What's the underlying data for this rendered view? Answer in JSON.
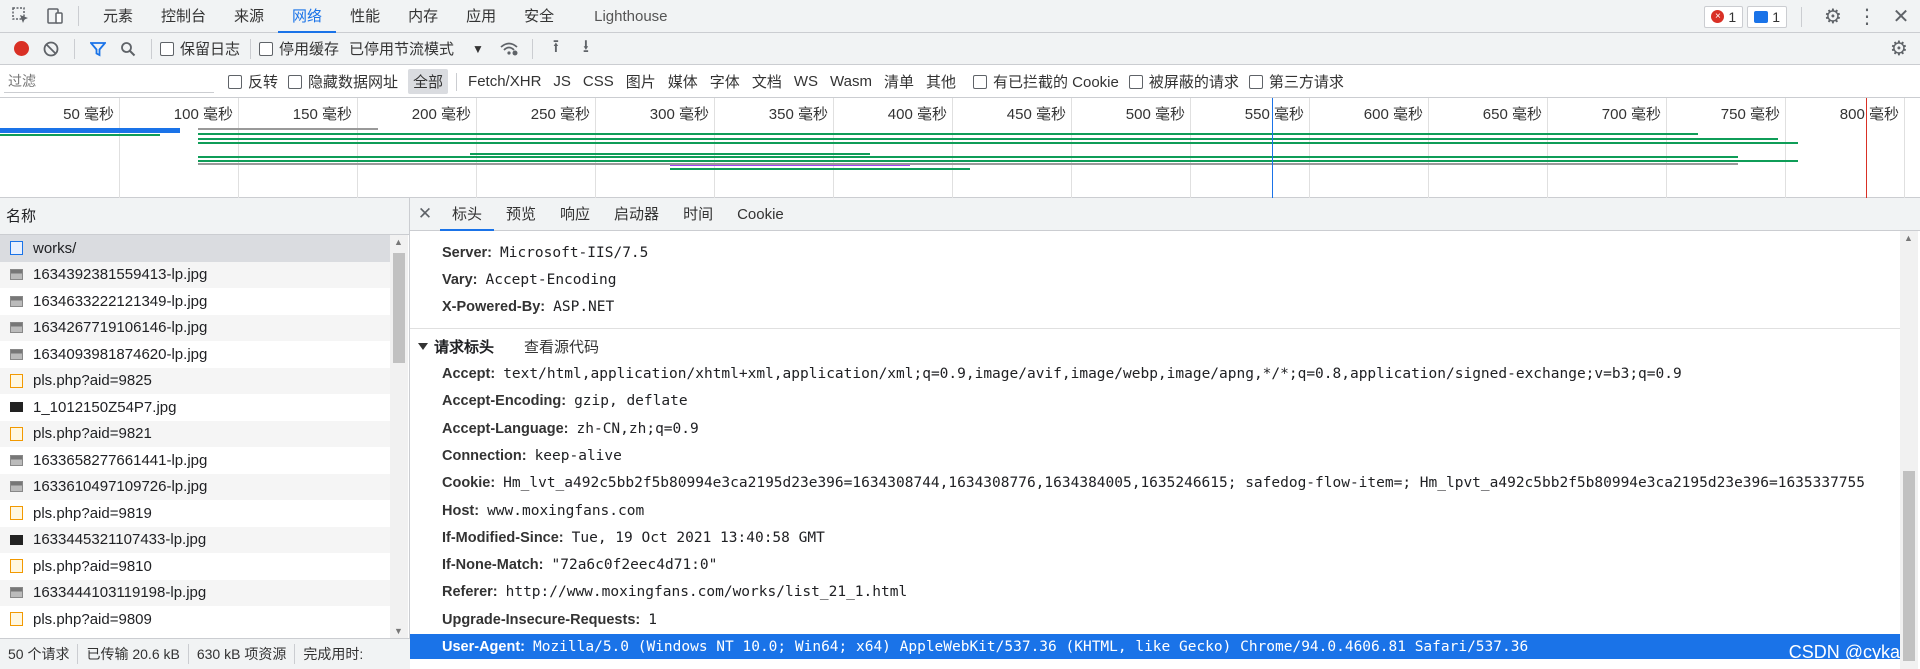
{
  "top_tabs": [
    "元素",
    "控制台",
    "来源",
    "网络",
    "性能",
    "内存",
    "应用",
    "安全"
  ],
  "lighthouse": "Lighthouse",
  "error_count": "1",
  "message_count": "1",
  "toolbar": {
    "preserve_log": "保留日志",
    "disable_cache": "停用缓存",
    "throttle": "已停用节流模式"
  },
  "filter": {
    "placeholder": "过滤",
    "invert": "反转",
    "hide_data_urls": "隐藏数据网址",
    "types": [
      "全部",
      "Fetch/XHR",
      "JS",
      "CSS",
      "图片",
      "媒体",
      "字体",
      "文档",
      "WS",
      "Wasm",
      "清单",
      "其他"
    ],
    "blocked_cookies": "有已拦截的 Cookie",
    "blocked_requests": "被屏蔽的请求",
    "third_party": "第三方请求"
  },
  "overview_ticks": [
    "50 毫秒",
    "100 毫秒",
    "150 毫秒",
    "200 毫秒",
    "250 毫秒",
    "300 毫秒",
    "350 毫秒",
    "400 毫秒",
    "450 毫秒",
    "500 毫秒",
    "550 毫秒",
    "600 毫秒",
    "650 毫秒",
    "700 毫秒",
    "750 毫秒",
    "800 毫秒"
  ],
  "left_header": "名称",
  "requests": [
    {
      "name": "works/",
      "type": "doc"
    },
    {
      "name": "1634392381559413-lp.jpg",
      "type": "img"
    },
    {
      "name": "1634633222121349-lp.jpg",
      "type": "img"
    },
    {
      "name": "1634267719106146-lp.jpg",
      "type": "img"
    },
    {
      "name": "1634093981874620-lp.jpg",
      "type": "img"
    },
    {
      "name": "pls.php?aid=9825",
      "type": "script"
    },
    {
      "name": "1_1012150Z54P7.jpg",
      "type": "dark"
    },
    {
      "name": "pls.php?aid=9821",
      "type": "script"
    },
    {
      "name": "1633658277661441-lp.jpg",
      "type": "img"
    },
    {
      "name": "1633610497109726-lp.jpg",
      "type": "img"
    },
    {
      "name": "pls.php?aid=9819",
      "type": "script"
    },
    {
      "name": "1633445321107433-lp.jpg",
      "type": "dark"
    },
    {
      "name": "pls.php?aid=9810",
      "type": "script"
    },
    {
      "name": "1633444103119198-lp.jpg",
      "type": "img"
    },
    {
      "name": "pls.php?aid=9809",
      "type": "script"
    }
  ],
  "status": {
    "requests": "50 个请求",
    "transferred": "已传输 20.6 kB",
    "resources": "630 kB 项资源",
    "finish": "完成用时:"
  },
  "detail_tabs": [
    "标头",
    "预览",
    "响应",
    "启动器",
    "时间",
    "Cookie"
  ],
  "response_headers": [
    {
      "k": "Server:",
      "v": "Microsoft-IIS/7.5"
    },
    {
      "k": "Vary:",
      "v": "Accept-Encoding"
    },
    {
      "k": "X-Powered-By:",
      "v": "ASP.NET"
    }
  ],
  "request_section": {
    "title": "请求标头",
    "view_source": "查看源代码"
  },
  "request_headers": [
    {
      "k": "Accept:",
      "v": "text/html,application/xhtml+xml,application/xml;q=0.9,image/avif,image/webp,image/apng,*/*;q=0.8,application/signed-exchange;v=b3;q=0.9"
    },
    {
      "k": "Accept-Encoding:",
      "v": "gzip, deflate"
    },
    {
      "k": "Accept-Language:",
      "v": "zh-CN,zh;q=0.9"
    },
    {
      "k": "Connection:",
      "v": "keep-alive"
    },
    {
      "k": "Cookie:",
      "v": "Hm_lvt_a492c5bb2f5b80994e3ca2195d23e396=1634308744,1634308776,1634384005,1635246615; safedog-flow-item=; Hm_lpvt_a492c5bb2f5b80994e3ca2195d23e396=1635337755"
    },
    {
      "k": "Host:",
      "v": "www.moxingfans.com"
    },
    {
      "k": "If-Modified-Since:",
      "v": "Tue, 19 Oct 2021 13:40:58 GMT"
    },
    {
      "k": "If-None-Match:",
      "v": "\"72a6c0f2eec4d71:0\""
    },
    {
      "k": "Referer:",
      "v": "http://www.moxingfans.com/works/list_21_1.html"
    },
    {
      "k": "Upgrade-Insecure-Requests:",
      "v": "1"
    },
    {
      "k": "User-Agent:",
      "v": "Mozilla/5.0 (Windows NT 10.0; Win64; x64) AppleWebKit/537.36 (KHTML, like Gecko) Chrome/94.0.4606.81 Safari/537.36"
    }
  ],
  "watermark": "CSDN @cyka"
}
